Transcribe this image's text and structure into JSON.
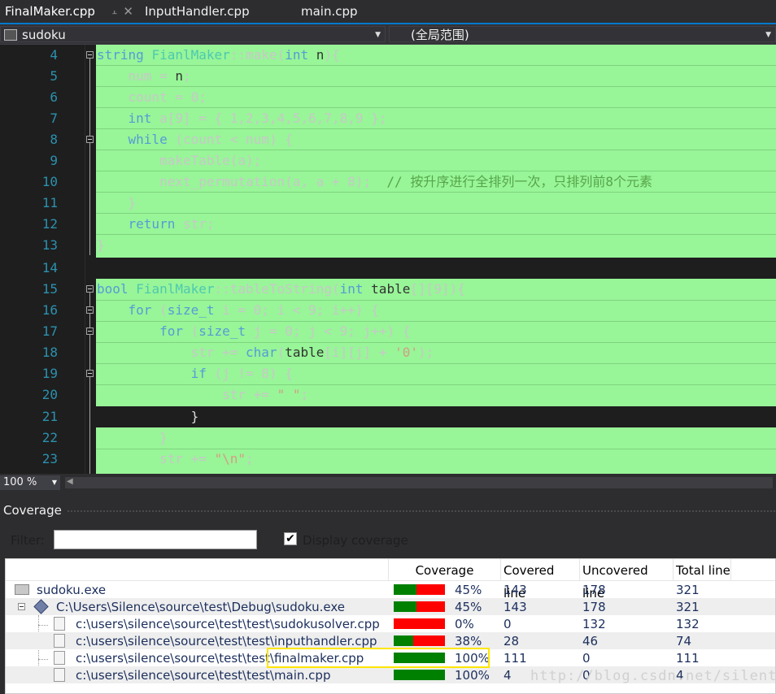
{
  "tabs": [
    {
      "label": "FinalMaker.cpp",
      "active": true
    },
    {
      "label": "InputHandler.cpp",
      "active": false
    },
    {
      "label": "main.cpp",
      "active": false
    }
  ],
  "nav": {
    "project": "sudoku",
    "scope": "(全局范围)"
  },
  "editor": {
    "line_numbers": [
      "4",
      "5",
      "6",
      "7",
      "8",
      "9",
      "10",
      "11",
      "12",
      "13",
      "14",
      "15",
      "16",
      "17",
      "18",
      "19",
      "20",
      "21",
      "22",
      "23"
    ]
  },
  "zoom": "100 %",
  "coverage": {
    "title": "Coverage",
    "filter_label": "Filter:",
    "filter_value": "",
    "display_coverage_label": "Display coverage",
    "display_coverage_checked": true,
    "columns": [
      "Coverage",
      "Covered line",
      "Uncovered line",
      "Total line"
    ],
    "rows": [
      {
        "name": "sudoku.exe",
        "percent": "45%",
        "fraction": 0.45,
        "covered": "143",
        "uncovered": "178",
        "total": "321"
      },
      {
        "name": "C:\\Users\\Silence\\source\\test\\Debug\\sudoku.exe",
        "percent": "45%",
        "fraction": 0.45,
        "covered": "143",
        "uncovered": "178",
        "total": "321"
      },
      {
        "name": "c:\\users\\silence\\source\\test\\test\\sudokusolver.cpp",
        "percent": "0%",
        "fraction": 0.0,
        "covered": "0",
        "uncovered": "132",
        "total": "132"
      },
      {
        "name": "c:\\users\\silence\\source\\test\\test\\inputhandler.cpp",
        "percent": "38%",
        "fraction": 0.38,
        "covered": "28",
        "uncovered": "46",
        "total": "74"
      },
      {
        "name_prefix": "c:\\users\\silence\\source\\test\\test\\",
        "name_suffix": "finalmaker.cpp",
        "percent": "100%",
        "fraction": 1.0,
        "covered": "111",
        "uncovered": "0",
        "total": "111"
      },
      {
        "name": "c:\\users\\silence\\source\\test\\test\\main.cpp",
        "percent": "100%",
        "fraction": 1.0,
        "covered": "4",
        "uncovered": "0",
        "total": "4"
      }
    ]
  },
  "watermark": "http://blog.csdn.net/silentic",
  "colors": {
    "covered": "#008000",
    "uncovered": "#ff0000",
    "line_covered_bg": "#98f598",
    "accent": "#007acc"
  }
}
